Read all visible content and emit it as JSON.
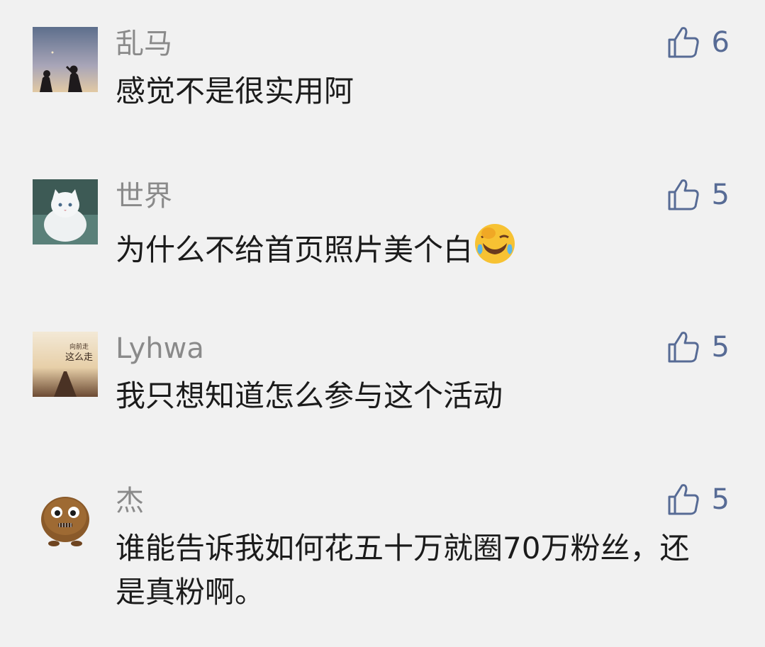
{
  "comments": [
    {
      "name": "乱马",
      "text": "感觉不是很实用阿",
      "likes": "6",
      "avatar": "silhouette-couple-avatar"
    },
    {
      "name": "世界",
      "text": "为什么不给首页照片美个白",
      "emoji": "laughing-crying-face-emoji",
      "likes": "5",
      "avatar": "white-cat-avatar"
    },
    {
      "name": "Lyhwa",
      "text": "我只想知道怎么参与这个活动",
      "likes": "5",
      "avatar": "road-poster-avatar",
      "avatar_text": [
        "向前走",
        "这么走"
      ]
    },
    {
      "name": "杰",
      "text": "谁能告诉我如何花五十万就圈70万粉丝，还是真粉啊。",
      "likes": "5",
      "avatar": "furry-monster-avatar"
    }
  ],
  "colors": {
    "name": "#8a8a8a",
    "text": "#1b1b1b",
    "like": "#576b95",
    "background": "#f1f1f1"
  },
  "like_icon": "thumbs-up-icon"
}
